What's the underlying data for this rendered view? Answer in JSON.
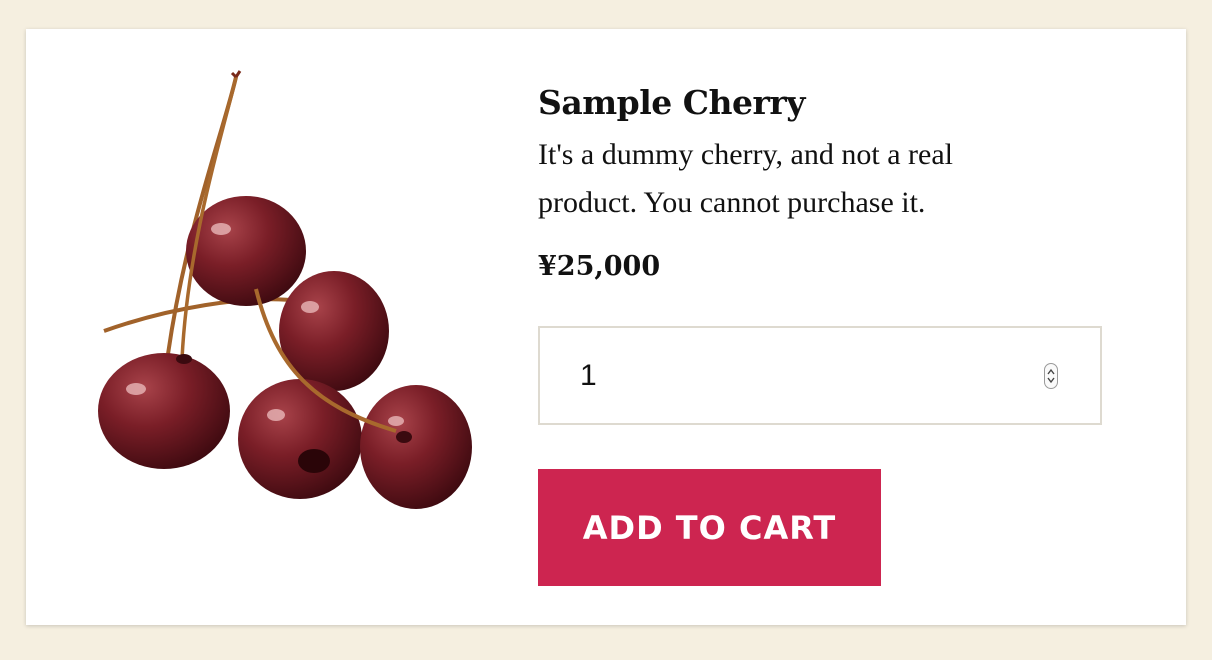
{
  "product": {
    "title": "Sample Cherry",
    "description": "It's a dummy cherry, and not a real product. You cannot purchase it.",
    "price": "¥25,000",
    "image_icon": "cherries-image"
  },
  "quantity": {
    "value": "1"
  },
  "cart": {
    "add_label": "ADD TO CART"
  },
  "colors": {
    "page_background": "#f5efe0",
    "card_background": "#ffffff",
    "button": "#cd2550",
    "input_border": "#dedad0"
  }
}
